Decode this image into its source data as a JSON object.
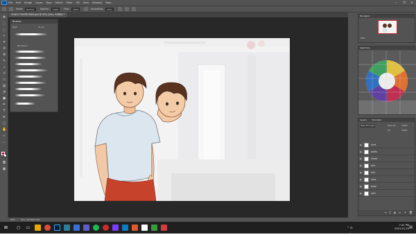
{
  "menu": {
    "app_badge": "Ps",
    "items": [
      "File",
      "Edit",
      "Image",
      "Layer",
      "Type",
      "Select",
      "Filter",
      "3D",
      "View",
      "Window",
      "Help"
    ]
  },
  "options": {
    "mode_label": "Mode:",
    "mode_value": "Normal",
    "opacity_label": "Opacity:",
    "opacity_value": "100%",
    "flow_label": "Flow:",
    "flow_value": "100%",
    "smoothing_label": "Smoothing:",
    "smoothing_value": "10%"
  },
  "document": {
    "tab_title": "ChARS TheFRB 9826.psd @ 50% (Sam, RGB/8) *"
  },
  "brushes_panel": {
    "title": "Brushes",
    "size_label": "Size:",
    "size_value": "21 px",
    "group_label": "Brushes 2"
  },
  "navigator": {
    "tab": "Navigator",
    "zoom": "50%"
  },
  "color_panel": {
    "tab": "Swatches"
  },
  "layers": {
    "tabs": [
      "Layers",
      "Channels"
    ],
    "blend_mode": "Pass Through",
    "opacity_label": "Opacity:",
    "opacity_value": "100%",
    "fill_label": "Fill:",
    "fill_value": "100%",
    "rows": [
      "shirt",
      "pants",
      "shoes",
      "skin",
      "hair",
      "eyes",
      "body",
      "sam"
    ]
  },
  "status": {
    "zoom": "50%",
    "doc_size": "Doc: 36.0M/2.35G"
  },
  "taskbar": {
    "time": "7:41 PM",
    "date": "2019-01-25"
  },
  "colors": {
    "chrome": "#535353",
    "pasteboard": "#282828",
    "foreground": "#c8003a",
    "taskbar": "#1f1f1f"
  }
}
